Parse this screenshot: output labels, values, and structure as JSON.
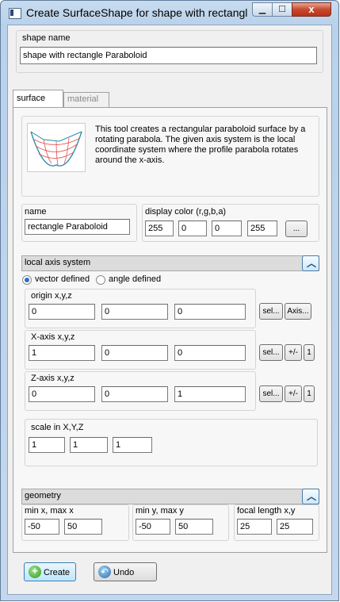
{
  "window": {
    "title": "Create SurfaceShape for shape with rectangl...",
    "close_glyph": "x",
    "icon": "app-window-icon"
  },
  "shape_name": {
    "label": "shape name",
    "value": "shape with rectangle Paraboloid"
  },
  "tabs": [
    {
      "label": "surface",
      "active": true
    },
    {
      "label": "material",
      "active": false
    }
  ],
  "description": "This tool creates a rectangular paraboloid surface by a rotating parabola. The given axis system is the local coordinate system where the profile parabola rotates around the x-axis.",
  "name_field": {
    "label": "name",
    "value": "rectangle Paraboloid"
  },
  "display_color": {
    "label": "display color (r,g,b,a)",
    "r": "255",
    "g": "0",
    "b": "0",
    "a": "255",
    "button": "..."
  },
  "local_axis": {
    "title": "local axis system",
    "radio_vector": "vector defined",
    "radio_angle": "angle defined",
    "selected": "vector defined",
    "origin": {
      "label": "origin x,y,z",
      "x": "0",
      "y": "0",
      "z": "0",
      "sel": "sel...",
      "axis": "Axis..."
    },
    "xaxis": {
      "label": "X-axis x,y,z",
      "x": "1",
      "y": "0",
      "z": "0",
      "sel": "sel...",
      "flip": "+/-",
      "unit": "1"
    },
    "zaxis": {
      "label": "Z-axis x,y,z",
      "x": "0",
      "y": "0",
      "z": "1",
      "sel": "sel...",
      "flip": "+/-",
      "unit": "1"
    },
    "scale": {
      "label": "scale in X,Y,Z",
      "x": "1",
      "y": "1",
      "z": "1"
    }
  },
  "geometry": {
    "title": "geometry",
    "x_range": {
      "label": "min x, max x",
      "min": "-50",
      "max": "50"
    },
    "y_range": {
      "label": "min y, max y",
      "min": "-50",
      "max": "50"
    },
    "focal": {
      "label": "focal length x,y",
      "x": "25",
      "y": "25"
    }
  },
  "buttons": {
    "create": "Create",
    "undo": "Undo"
  },
  "colors": {
    "accent": "#1f4f7f",
    "close": "#c7492e"
  }
}
